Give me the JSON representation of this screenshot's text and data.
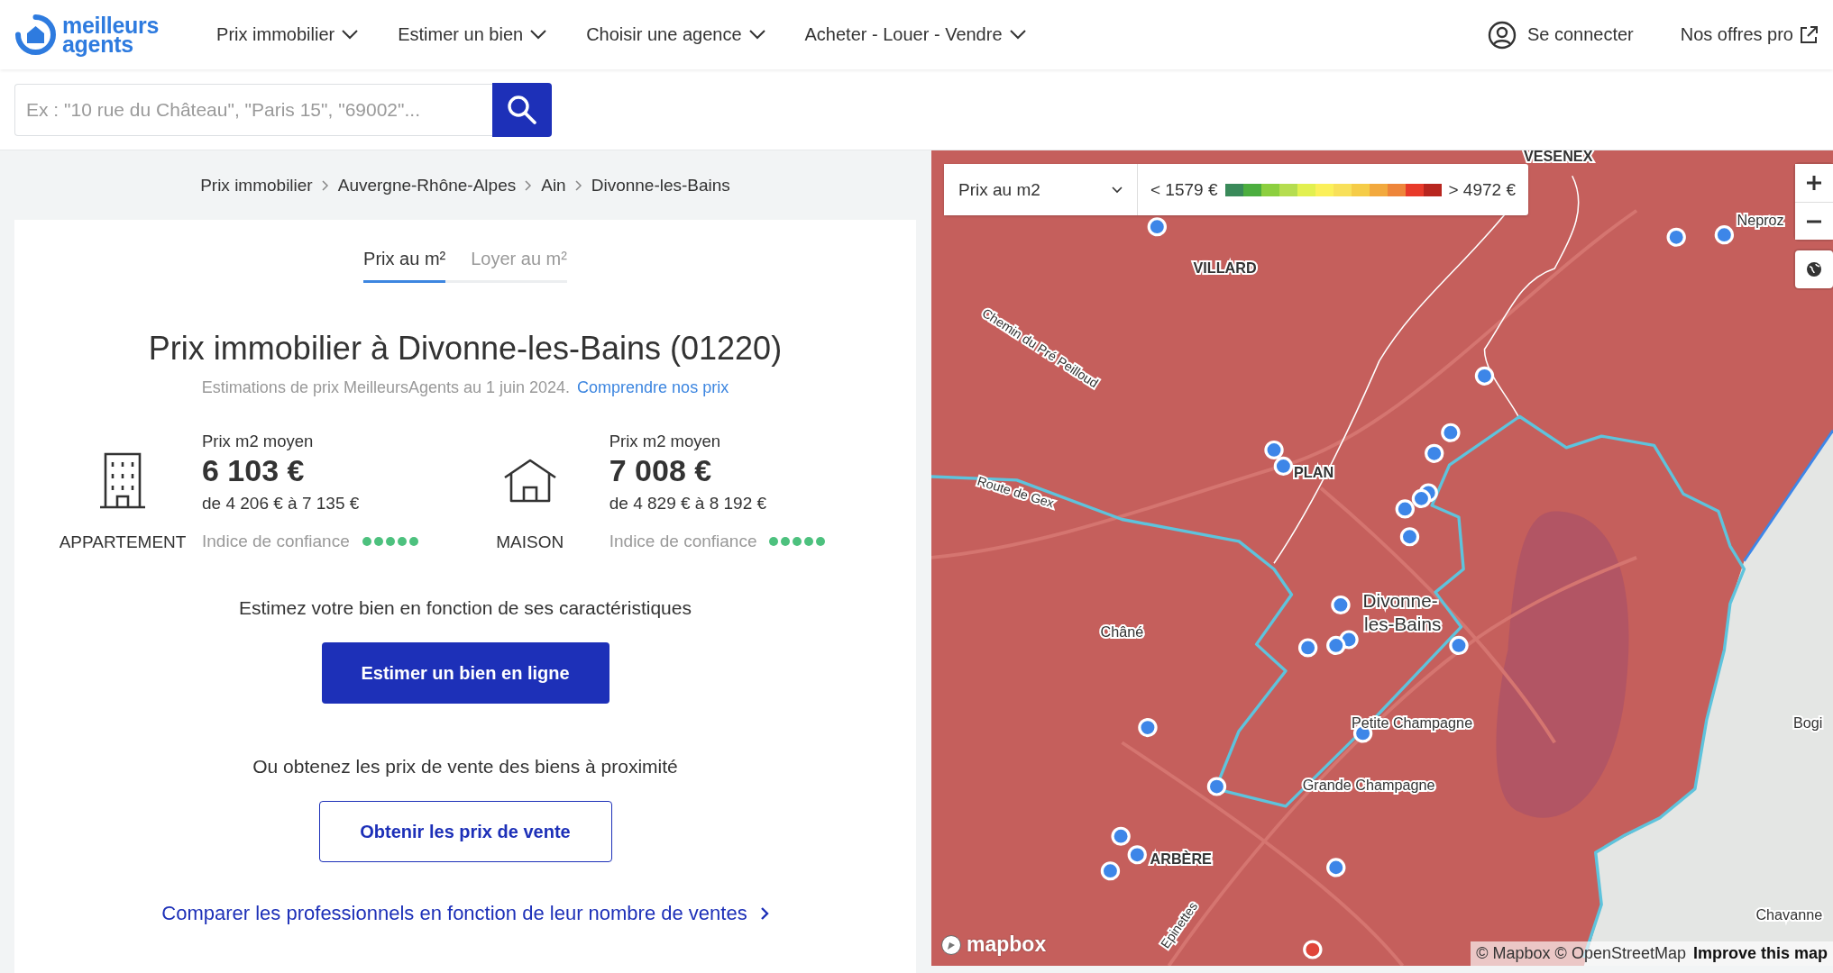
{
  "header": {
    "logo": {
      "line_1": "meilleurs",
      "line_2": "agents"
    },
    "nav": [
      {
        "label": "Prix immobilier"
      },
      {
        "label": "Estimer un bien"
      },
      {
        "label": "Choisir une agence"
      },
      {
        "label": "Acheter - Louer - Vendre"
      }
    ],
    "login": "Se connecter",
    "pro_link": "Nos offres pro"
  },
  "search": {
    "placeholder": "Ex : \"10 rue du Château\", \"Paris 15\", \"69002\"..."
  },
  "breadcrumb": [
    "Prix immobilier",
    "Auvergne-Rhône-Alpes",
    "Ain",
    "Divonne-les-Bains"
  ],
  "tabs": [
    {
      "label": "Prix au m²",
      "selected": true
    },
    {
      "label": "Loyer au m²",
      "selected": false
    }
  ],
  "title": "Prix immobilier à Divonne-les-Bains (01220)",
  "subtitle": "Estimations de prix MeilleursAgents au 1 juin 2024.",
  "subtitle_link": "Comprendre nos prix",
  "properties": [
    {
      "kind": "apartment",
      "type_label": "APPARTEMENT",
      "price_label": "Prix m2 moyen",
      "price": "6 103 €",
      "range": "de 4 206 € à 7 135 €",
      "confidence_label": "Indice de confiance",
      "stars": 5
    },
    {
      "kind": "house",
      "type_label": "MAISON",
      "price_label": "Prix m2 moyen",
      "price": "7 008 €",
      "range": "de 4 829 € à 8 192 €",
      "confidence_label": "Indice de confiance",
      "stars": 5
    }
  ],
  "estimate": {
    "text": "Estimez votre bien en fonction de ses caractéristiques",
    "button": "Estimer un bien en ligne"
  },
  "sales": {
    "text": "Ou obtenez les prix de vente des biens à proximité",
    "button": "Obtenir les prix de vente"
  },
  "compare_link": "Comparer les professionnels en fonction de leur nombre de ventes",
  "map": {
    "selector": "Prix au m2",
    "legend_min": "< 1579 €",
    "legend_max": "> 4972 €",
    "labels": [
      {
        "text": "VESENEX"
      },
      {
        "text": "VILLARD"
      },
      {
        "text": "Chemin du Pré Peilloud"
      },
      {
        "text": "Neproz"
      },
      {
        "text": "PLAN"
      },
      {
        "text": "Route de Gex"
      },
      {
        "text": "Divonne-"
      },
      {
        "text": "Châné"
      },
      {
        "text": "les-Bains"
      },
      {
        "text": "Petite Champagne"
      },
      {
        "text": "Grande Champagne"
      },
      {
        "text": "ARBÈRE"
      },
      {
        "text": "Bogi"
      },
      {
        "text": "Chavanne"
      },
      {
        "text": "Epinettes"
      }
    ],
    "logo": "mapbox",
    "attribution": "© Mapbox © OpenStreetMap",
    "improve_link": "Improve this map"
  }
}
